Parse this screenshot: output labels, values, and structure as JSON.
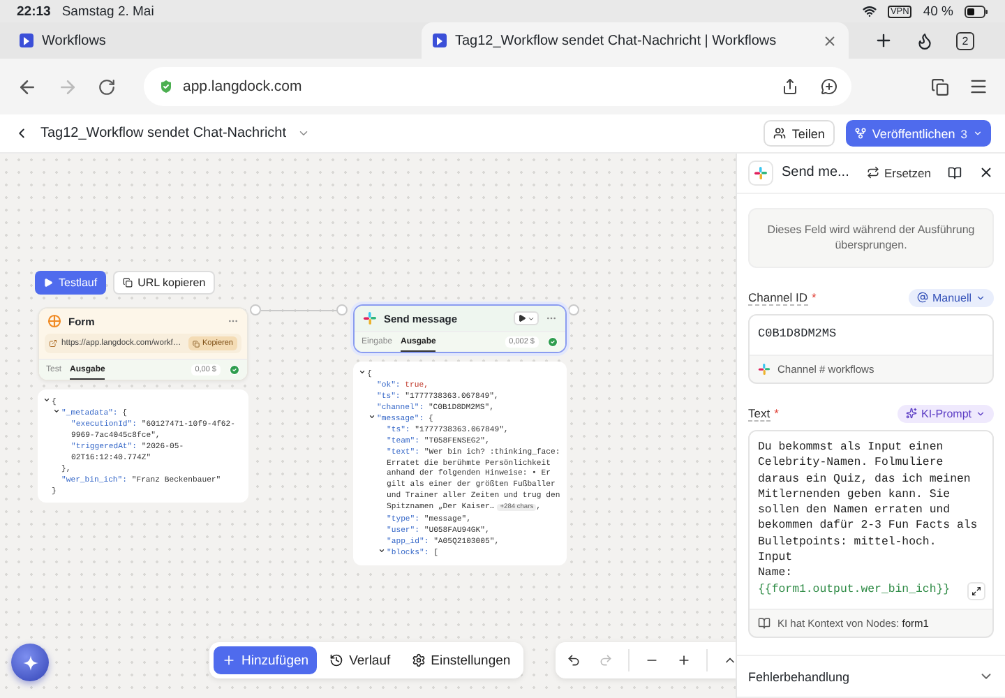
{
  "status_bar": {
    "time": "22:13",
    "date": "Samstag 2. Mai",
    "vpn": "VPN",
    "battery": "40 %"
  },
  "browser": {
    "tabs": [
      {
        "title": "Workflows",
        "selected": false
      },
      {
        "title": "Tag12_Workflow sendet Chat-Nachricht | Workflows",
        "selected": true
      }
    ],
    "tab_count": "2",
    "forward_disabled": true,
    "url": "app.langdock.com"
  },
  "header": {
    "title": "Tag12_Workflow sendet Chat-Nachricht",
    "share": "Teilen",
    "publish": "Veröffentlichen",
    "publish_count": "3"
  },
  "canvas": {
    "actions": [
      {
        "label": "Testlauf",
        "kind": "primary"
      },
      {
        "label": "URL kopieren",
        "kind": "secondary"
      }
    ],
    "nodes": [
      {
        "kind": "form",
        "title": "Form",
        "selected": false,
        "url": "https://app.langdock.com/workf…",
        "copy": "Kopieren",
        "tabs": [
          {
            "label": "Test",
            "selected": false
          },
          {
            "label": "Ausgabe",
            "selected": true
          }
        ],
        "cost": "0,00 $",
        "success": true,
        "output": {
          "open": "{",
          "expanded": true,
          "close": "}",
          "children": [
            {
              "key": "\"_metadata\":",
              "open": "{",
              "expanded": true,
              "close": "},",
              "children": [
                {
                  "key": "\"executionId\":",
                  "value": "\"60127471-10f9-4f62-9969-7ac4045c8fce\",",
                  "kind": "string"
                },
                {
                  "key": "\"triggeredAt\":",
                  "value": "\"2026-05-02T16:12:40.774Z\"",
                  "kind": "string"
                }
              ]
            },
            {
              "key": "\"wer_bin_ich\":",
              "value": "\"Franz Beckenbauer\"",
              "kind": "string"
            }
          ]
        }
      },
      {
        "kind": "slack",
        "title": "Send message",
        "selected": true,
        "tabs": [
          {
            "label": "Eingabe",
            "selected": false
          },
          {
            "label": "Ausgabe",
            "selected": true
          }
        ],
        "cost": "0,002 $",
        "success": true,
        "output": {
          "open": "{",
          "expanded": true,
          "children": [
            {
              "key": "\"ok\":",
              "value": "true,",
              "kind": "boolean"
            },
            {
              "key": "\"ts\":",
              "value": "\"1777738363.067849\",",
              "kind": "string"
            },
            {
              "key": "\"channel\":",
              "value": "\"C0B1D8DM2MS\",",
              "kind": "string"
            },
            {
              "key": "\"message\":",
              "open": "{",
              "expanded": true,
              "children": [
                {
                  "key": "\"ts\":",
                  "value": "\"1777738363.067849\",",
                  "kind": "string"
                },
                {
                  "key": "\"team\":",
                  "value": "\"T058FENSEG2\",",
                  "kind": "string"
                },
                {
                  "key": "\"text\":",
                  "value": "\"Wer bin ich? :thinking_face: Erratet die berühmte Persönlichkeit anhand der folgenden Hinweise: • Er gilt als einer der größten Fußballer und Trainer aller Zeiten und trug den Spitznamen „Der Kaiser…",
                  "more": "+284 chars",
                  "after": ",",
                  "kind": "string"
                },
                {
                  "key": "\"type\":",
                  "value": "\"message\",",
                  "kind": "string"
                },
                {
                  "key": "\"user\":",
                  "value": "\"U058FAU94GK\",",
                  "kind": "string"
                },
                {
                  "key": "\"app_id\":",
                  "value": "\"A05Q2103005\",",
                  "kind": "string"
                },
                {
                  "key": "\"blocks\":",
                  "open": "[",
                  "expanded": true
                }
              ]
            }
          ]
        }
      }
    ]
  },
  "toolbar": {
    "buttons": [
      {
        "label": "Hinzufügen",
        "kind": "add"
      },
      {
        "label": "Verlauf",
        "kind": "history"
      },
      {
        "label": "Einstellungen",
        "kind": "settings"
      }
    ],
    "controls": [
      {
        "kind": "undo",
        "disabled": false
      },
      {
        "kind": "redo",
        "disabled": true
      },
      {
        "kind": "zoom-out",
        "disabled": false
      },
      {
        "kind": "zoom-in",
        "disabled": false
      },
      {
        "kind": "collapse",
        "disabled": false
      }
    ]
  },
  "panel": {
    "title": "Send me...",
    "replace": "Ersetzen",
    "skipped_note": "Dieses Feld wird während der Ausführung übersprungen.",
    "fields": [
      {
        "kind": "input",
        "label": "Channel ID",
        "required_mark": "*",
        "mode": "Manuell",
        "value": "C0B1D8DM2MS",
        "footer": "Channel # workflows"
      },
      {
        "kind": "prompt",
        "label": "Text",
        "required_mark": "*",
        "mode": "KI-Prompt",
        "value": "Du bekommst als Input einen Celebrity-Namen. Folmuliere daraus ein Quiz, das ich meinen Mitlernenden geben kann. Sie sollen den Namen erraten und bekommen dafür 2-3 Fun Facts als Bulletpoints: mittel-hoch.\nInput\nName:",
        "variable": "{{form1.output.wer_bin_ich}}",
        "footer": "KI hat Kontext von Nodes:",
        "footer_value": "form1"
      }
    ],
    "sections": [
      {
        "title": "Fehlerbehandlung",
        "expanded": false
      }
    ]
  }
}
